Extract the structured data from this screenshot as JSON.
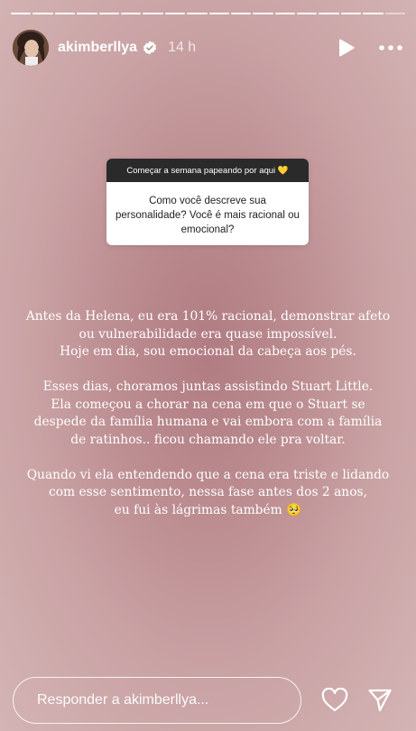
{
  "story": {
    "segments_total": 18,
    "segments_viewed": 17
  },
  "header": {
    "username": "akimberllya",
    "time": "14 h",
    "verified_icon": "verified-badge-icon",
    "play_icon": "play-icon",
    "more_icon": "more-options-icon"
  },
  "question": {
    "prompt": "Começar a semana papeando por aqui 💛",
    "text": "Como você descreve sua personalidade? Você é mais racional ou emocional?"
  },
  "answer": {
    "paragraph1": "Antes da Helena, eu era 101% racional, demonstrar afeto\nou vulnerabilidade era quase impossível.\nHoje em dia, sou emocional da cabeça aos pés.",
    "paragraph2": "Esses dias, choramos juntas assistindo Stuart Little.\nEla começou a chorar na cena em que o Stuart se\ndespede da família humana e vai embora com a família\nde ratinhos.. ficou chamando ele pra voltar.",
    "paragraph3": "Quando vi ela entendendo que a cena era triste e lidando\ncom esse sentimento, nessa fase antes dos 2 anos,\neu fui às lágrimas também 🥺"
  },
  "footer": {
    "reply_placeholder": "Responder a akimberllya...",
    "like_icon": "heart-icon",
    "share_icon": "send-icon"
  }
}
